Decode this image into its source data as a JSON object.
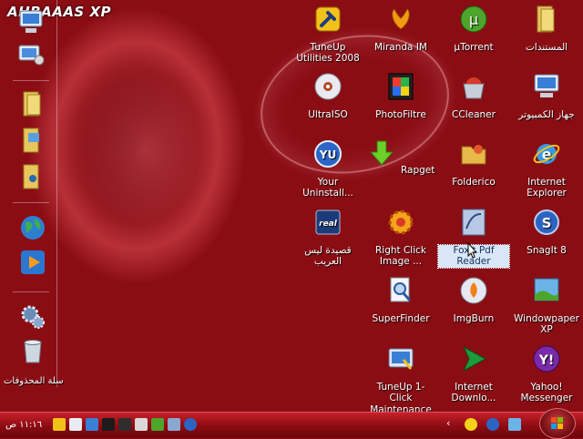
{
  "brand": "AHBAAAS XP",
  "recycle_bin_label": "سلة المحذوفات",
  "clock": "١١:١٦ ص",
  "icons": [
    {
      "label": "TuneUp Utilities 2008"
    },
    {
      "label": "Miranda IM"
    },
    {
      "label": "µTorrent"
    },
    {
      "label": "المستندات"
    },
    {
      "label": "UltraISO"
    },
    {
      "label": "PhotoFiltre"
    },
    {
      "label": "CCleaner"
    },
    {
      "label": "جهاز الكمبيوتر"
    },
    {
      "label": "Your Uninstall..."
    },
    {
      "label": "Rapget"
    },
    {
      "label": "Folderico"
    },
    {
      "label": "Internet Explorer"
    },
    {
      "label": "قصيدة ليس العريب"
    },
    {
      "label": "Right Click Image ..."
    },
    {
      "label": "Foxit Pdf Reader"
    },
    {
      "label": "SnagIt 8"
    },
    {
      "label": "SuperFinder"
    },
    {
      "label": "ImgBurn"
    },
    {
      "label": "Windowpaper XP"
    },
    {
      "label": "TuneUp 1-Click Maintenance"
    },
    {
      "label": "Internet Downlo..."
    },
    {
      "label": "Yahoo! Messenger"
    }
  ],
  "colors": {
    "desktop": "#8a0d14",
    "taskbar": "#a8121b",
    "selection": "#d8e6f8"
  }
}
